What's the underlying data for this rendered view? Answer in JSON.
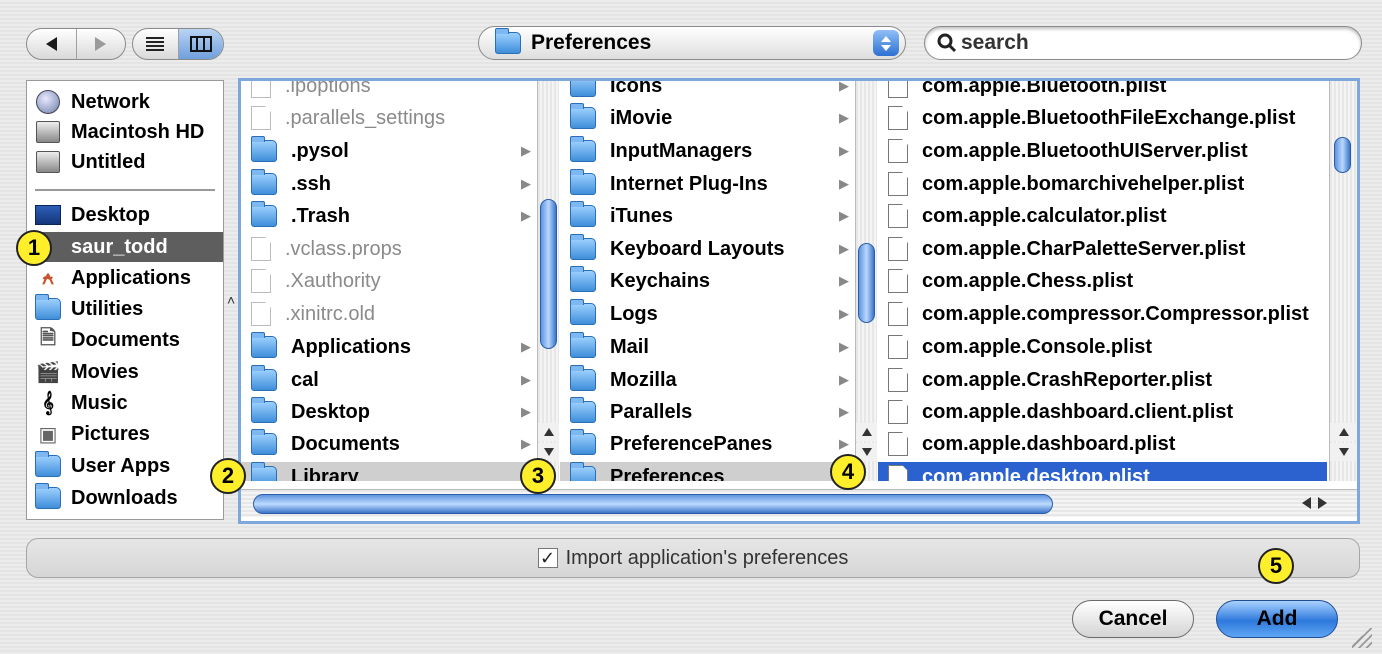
{
  "toolbar": {
    "back_icon": "back-arrow-icon",
    "forward_icon": "forward-arrow-icon",
    "list_view_icon": "list-view-icon",
    "column_view_icon": "column-view-icon",
    "location": "Preferences",
    "search_placeholder": "search"
  },
  "sidebar": {
    "devices": [
      {
        "label": "Network",
        "icon": "network-globe-icon"
      },
      {
        "label": "Macintosh HD",
        "icon": "hard-disk-icon"
      },
      {
        "label": "Untitled",
        "icon": "hard-disk-icon"
      }
    ],
    "places": [
      {
        "label": "Desktop",
        "icon": "desktop-icon"
      },
      {
        "label": "saur_todd",
        "icon": "home-icon",
        "selected": true
      },
      {
        "label": "Applications",
        "icon": "applications-icon"
      },
      {
        "label": "Utilities",
        "icon": "folder-icon"
      },
      {
        "label": "Documents",
        "icon": "documents-icon"
      },
      {
        "label": "Movies",
        "icon": "movies-icon"
      },
      {
        "label": "Music",
        "icon": "music-icon"
      },
      {
        "label": "Pictures",
        "icon": "pictures-icon"
      },
      {
        "label": "User Apps",
        "icon": "folder-icon"
      },
      {
        "label": "Downloads",
        "icon": "folder-icon"
      }
    ]
  },
  "columns": {
    "home": [
      {
        "label": ".ipoptions",
        "kind": "file",
        "dim": true
      },
      {
        "label": ".parallels_settings",
        "kind": "file",
        "dim": true
      },
      {
        "label": ".pysol",
        "kind": "folder"
      },
      {
        "label": ".ssh",
        "kind": "folder"
      },
      {
        "label": ".Trash",
        "kind": "folder"
      },
      {
        "label": ".vclass.props",
        "kind": "file",
        "dim": true
      },
      {
        "label": ".Xauthority",
        "kind": "file",
        "dim": true
      },
      {
        "label": ".xinitrc.old",
        "kind": "file",
        "dim": true
      },
      {
        "label": "Applications",
        "kind": "folder"
      },
      {
        "label": "cal",
        "kind": "folder"
      },
      {
        "label": "Desktop",
        "kind": "folder"
      },
      {
        "label": "Documents",
        "kind": "folder"
      },
      {
        "label": "Library",
        "kind": "folder",
        "selected": true
      }
    ],
    "library": [
      {
        "label": "Icons",
        "kind": "folder"
      },
      {
        "label": "iMovie",
        "kind": "folder"
      },
      {
        "label": "InputManagers",
        "kind": "folder"
      },
      {
        "label": "Internet Plug-Ins",
        "kind": "folder"
      },
      {
        "label": "iTunes",
        "kind": "folder"
      },
      {
        "label": "Keyboard Layouts",
        "kind": "folder"
      },
      {
        "label": "Keychains",
        "kind": "folder"
      },
      {
        "label": "Logs",
        "kind": "folder"
      },
      {
        "label": "Mail",
        "kind": "folder"
      },
      {
        "label": "Mozilla",
        "kind": "folder"
      },
      {
        "label": "Parallels",
        "kind": "folder"
      },
      {
        "label": "PreferencePanes",
        "kind": "folder"
      },
      {
        "label": "Preferences",
        "kind": "folder",
        "selected": true
      }
    ],
    "preferences": [
      {
        "label": "com.apple.Bluetooth.plist",
        "kind": "file"
      },
      {
        "label": "com.apple.BluetoothFileExchange.plist",
        "kind": "file"
      },
      {
        "label": "com.apple.BluetoothUIServer.plist",
        "kind": "file"
      },
      {
        "label": "com.apple.bomarchivehelper.plist",
        "kind": "file"
      },
      {
        "label": "com.apple.calculator.plist",
        "kind": "file"
      },
      {
        "label": "com.apple.CharPaletteServer.plist",
        "kind": "file"
      },
      {
        "label": "com.apple.Chess.plist",
        "kind": "file"
      },
      {
        "label": "com.apple.compressor.Compressor.plist",
        "kind": "file"
      },
      {
        "label": "com.apple.Console.plist",
        "kind": "file"
      },
      {
        "label": "com.apple.CrashReporter.plist",
        "kind": "file"
      },
      {
        "label": "com.apple.dashboard.client.plist",
        "kind": "file"
      },
      {
        "label": "com.apple.dashboard.plist",
        "kind": "file"
      },
      {
        "label": "com.apple.desktop.plist",
        "kind": "file",
        "selected": true
      }
    ]
  },
  "options": {
    "import_label": "Import application's preferences",
    "import_checked": true
  },
  "buttons": {
    "cancel": "Cancel",
    "add": "Add"
  },
  "callouts": [
    "1",
    "2",
    "3",
    "4",
    "5"
  ],
  "colors": {
    "selection_blue": "#2b62d0",
    "callout_yellow": "#ffef2a",
    "sidebar_selected": "#5e5e5e"
  }
}
